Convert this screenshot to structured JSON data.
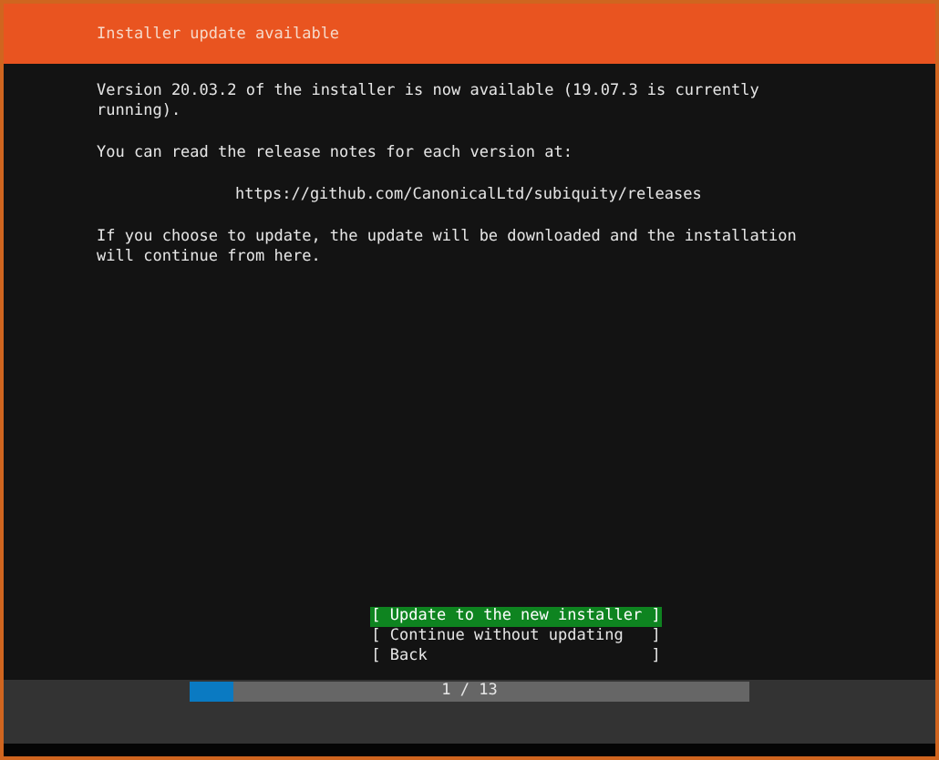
{
  "header": {
    "title": "Installer update available"
  },
  "paragraphs": [
    {
      "kind": "text",
      "text": "Version 20.03.2 of the installer is now available (19.07.3 is currently\nrunning)."
    },
    {
      "kind": "text",
      "text": "You can read the release notes for each version at:"
    },
    {
      "kind": "url",
      "text": "https://github.com/CanonicalLtd/subiquity/releases"
    },
    {
      "kind": "text",
      "text": "If you choose to update, the update will be downloaded and the installation\nwill continue from here."
    }
  ],
  "buttons": [
    {
      "label": "[ Update to the new installer ]",
      "selected": true
    },
    {
      "label": "[ Continue without updating   ]",
      "selected": false
    },
    {
      "label": "[ Back                        ]",
      "selected": false
    }
  ],
  "progress": {
    "level": 0.077,
    "text": "1 / 13"
  }
}
